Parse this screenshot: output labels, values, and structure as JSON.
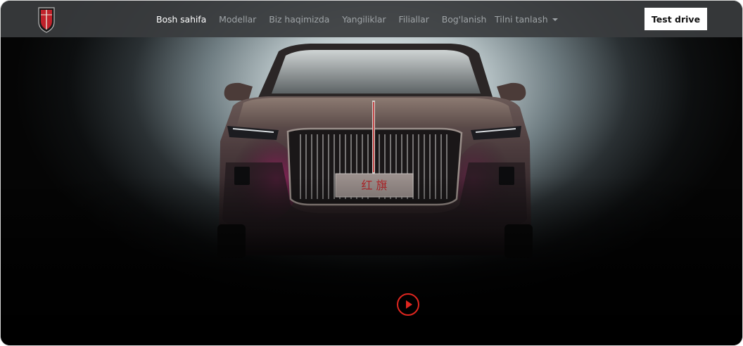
{
  "brand": {
    "logo_icon": "hongqi-shield-logo-icon",
    "accent_color": "#e0261f"
  },
  "nav": {
    "items": [
      {
        "label": "Bosh sahifa",
        "active": true
      },
      {
        "label": "Modellar",
        "active": false
      },
      {
        "label": "Biz haqimizda",
        "active": false
      },
      {
        "label": "Yangiliklar",
        "active": false
      },
      {
        "label": "Filiallar",
        "active": false
      },
      {
        "label": "Bog'lanish",
        "active": false
      }
    ],
    "language_label": "Tilni tanlash",
    "cta_label": "Test drive"
  },
  "hero": {
    "plate_text": "红 旗",
    "play_icon": "play-icon"
  }
}
